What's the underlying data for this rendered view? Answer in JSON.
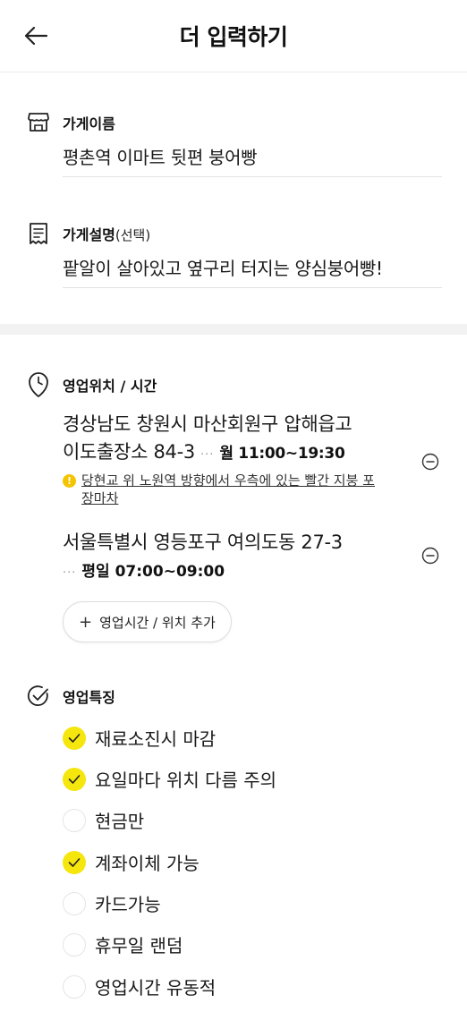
{
  "header": {
    "title": "더 입력하기"
  },
  "store_name": {
    "label": "가게이름",
    "value": "평촌역 이마트 뒷편 붕어빵"
  },
  "store_desc": {
    "label": "가게설명",
    "optional": "(선택)",
    "value": "팥알이 살아있고 옆구리 터지는 양심붕어빵!"
  },
  "hours": {
    "label": "영업위치 / 시간",
    "locations": [
      {
        "address_line1": "경상남도 창원시 마산회원구 압해읍고",
        "address_line2": "이도출장소 84-3",
        "time": "월 11:00~19:30",
        "note": "당현교 위 노원역 방향에서 우측에 있는 빨간 지붕 포장마차"
      },
      {
        "address_line1": "서울특별시 영등포구 여의도동 27-3",
        "time": "평일 07:00~09:00"
      }
    ],
    "add_button": "영업시간 / 위치 추가"
  },
  "features": {
    "label": "영업특징",
    "items": [
      {
        "label": "재료소진시 마감",
        "checked": true
      },
      {
        "label": "요일마다 위치 다름 주의",
        "checked": true
      },
      {
        "label": "현금만",
        "checked": false
      },
      {
        "label": "계좌이체 가능",
        "checked": true
      },
      {
        "label": "카드가능",
        "checked": false
      },
      {
        "label": "휴무일 랜덤",
        "checked": false
      },
      {
        "label": "영업시간 유동적",
        "checked": false
      }
    ]
  },
  "colors": {
    "accent": "#f5e60d",
    "warning": "#f5c400",
    "divider": "#f2f2f2"
  },
  "icons": {
    "back": "arrow-left-icon",
    "store": "store-awning-icon",
    "description": "receipt-icon",
    "hours": "clock-icon",
    "features": "check-circle-icon",
    "remove": "minus-circle-icon",
    "warning": "exclamation-icon",
    "add": "plus-icon",
    "check": "check-icon"
  }
}
